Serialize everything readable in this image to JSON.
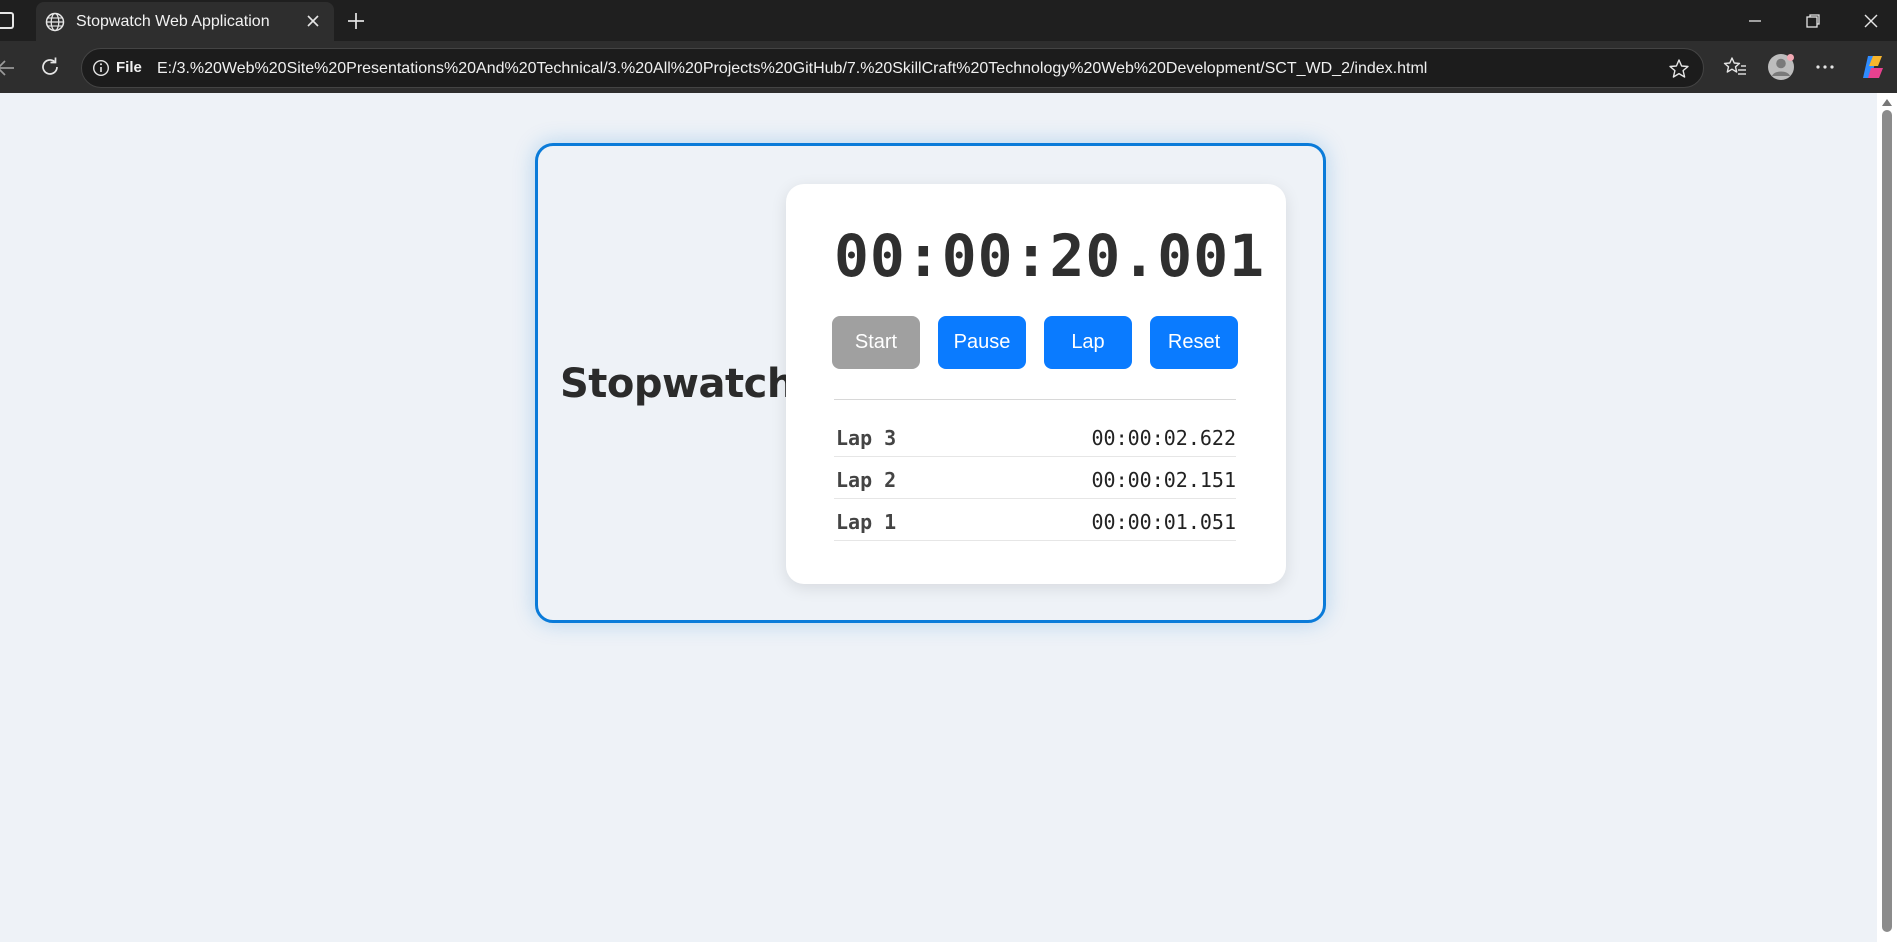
{
  "browser": {
    "tab_title": "Stopwatch Web Application",
    "scheme_label": "File",
    "url": "E:/3.%20Web%20Site%20Presentations%20And%20Technical/3.%20All%20Projects%20GitHub/7.%20SkillCraft%20Technology%20Web%20Development/SCT_WD_2/index.html"
  },
  "page": {
    "heading": "Stopwatch",
    "time": "00:00:20.001",
    "buttons": {
      "start": "Start",
      "pause": "Pause",
      "lap": "Lap",
      "reset": "Reset"
    },
    "laps": [
      {
        "name": "Lap 3",
        "time": "00:00:02.622"
      },
      {
        "name": "Lap 2",
        "time": "00:00:02.151"
      },
      {
        "name": "Lap 1",
        "time": "00:00:01.051"
      }
    ]
  },
  "colors": {
    "accent": "#0a7bff",
    "border": "#0a7bd9",
    "disabled": "#a0a0a0",
    "page_bg": "#eef2f7"
  }
}
